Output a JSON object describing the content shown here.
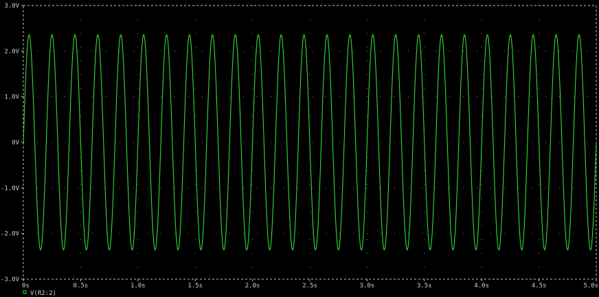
{
  "chart_data": {
    "type": "line",
    "xlabel": "",
    "ylabel": "",
    "xlim": [
      0,
      5.0
    ],
    "ylim": [
      -3.0,
      3.0
    ],
    "x_ticks": [
      0,
      0.5,
      1.0,
      1.5,
      2.0,
      2.5,
      3.0,
      3.5,
      4.0,
      4.5,
      5.0
    ],
    "x_tick_labels": [
      "0s",
      "0.5s",
      "1.0s",
      "1.5s",
      "2.0s",
      "2.5s",
      "3.0s",
      "3.5s",
      "4.0s",
      "4.5s",
      "5.0s"
    ],
    "y_ticks": [
      3.0,
      2.0,
      1.0,
      0,
      -1.0,
      -2.0,
      -3.0
    ],
    "y_tick_labels": [
      "3.0V",
      "2.0V",
      "1.0V",
      "0V",
      "-1.0V",
      "-2.0V",
      "-3.0V"
    ],
    "grid": "dotted",
    "legend_position": "bottom-left",
    "series": [
      {
        "name": "V(R2:2)",
        "color": "#33dd33",
        "waveform": "sine",
        "amplitude": 2.36,
        "frequency_hz": 5.0,
        "offset": 0.0,
        "phase_deg": 0
      }
    ],
    "colors": {
      "background": "#000000",
      "axes": "#c8c8c8",
      "grid": "#8a8a8a"
    }
  }
}
